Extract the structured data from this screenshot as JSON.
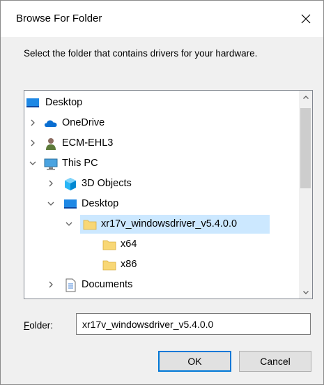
{
  "window": {
    "title": "Browse For Folder"
  },
  "instruction": "Select the folder that contains drivers for your hardware.",
  "tree": {
    "items": [
      {
        "label": "Desktop",
        "expand": "none",
        "icon": "desktop-icon",
        "selected": false
      },
      {
        "label": "OneDrive",
        "expand": "collapsed",
        "icon": "onedrive-cloud-icon",
        "selected": false
      },
      {
        "label": "ECM-EHL3",
        "expand": "collapsed",
        "icon": "user-icon",
        "selected": false
      },
      {
        "label": "This PC",
        "expand": "expanded",
        "icon": "computer-icon",
        "selected": false
      },
      {
        "label": "3D Objects",
        "expand": "collapsed",
        "icon": "3d-objects-icon",
        "selected": false
      },
      {
        "label": "Desktop",
        "expand": "expanded",
        "icon": "desktop-icon",
        "selected": false
      },
      {
        "label": "xr17v_windowsdriver_v5.4.0.0",
        "expand": "expanded",
        "icon": "folder-icon",
        "selected": true
      },
      {
        "label": "x64",
        "expand": "none",
        "icon": "folder-icon",
        "selected": false
      },
      {
        "label": "x86",
        "expand": "none",
        "icon": "folder-icon",
        "selected": false
      },
      {
        "label": "Documents",
        "expand": "collapsed",
        "icon": "documents-icon",
        "selected": false
      }
    ],
    "selection_color": "#cce8ff"
  },
  "folder": {
    "label_underline": "F",
    "label_rest": "older:",
    "value": "xr17v_windowsdriver_v5.4.0.0"
  },
  "buttons": {
    "ok": "OK",
    "cancel": "Cancel"
  },
  "colors": {
    "accent": "#0078d7",
    "dialog_bg": "#f0f0f0"
  }
}
